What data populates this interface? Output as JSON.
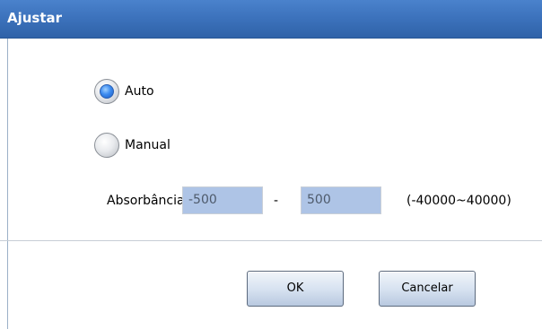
{
  "window": {
    "title": "Ajustar"
  },
  "mode": {
    "selected": "Auto",
    "options": [
      {
        "label": "Auto",
        "selected": true
      },
      {
        "label": "Manual",
        "selected": false
      }
    ]
  },
  "absorbance": {
    "label": "Absorbância",
    "min_value": "-500",
    "separator": "-",
    "max_value": "500",
    "range_hint": "(-40000~40000)"
  },
  "buttons": {
    "ok_label": "OK",
    "cancel_label": "Cancelar"
  },
  "colors": {
    "titlebar": "#3d73bd",
    "radio_selected": "#3d8cf0",
    "textbox_bg": "#aec4e6"
  }
}
